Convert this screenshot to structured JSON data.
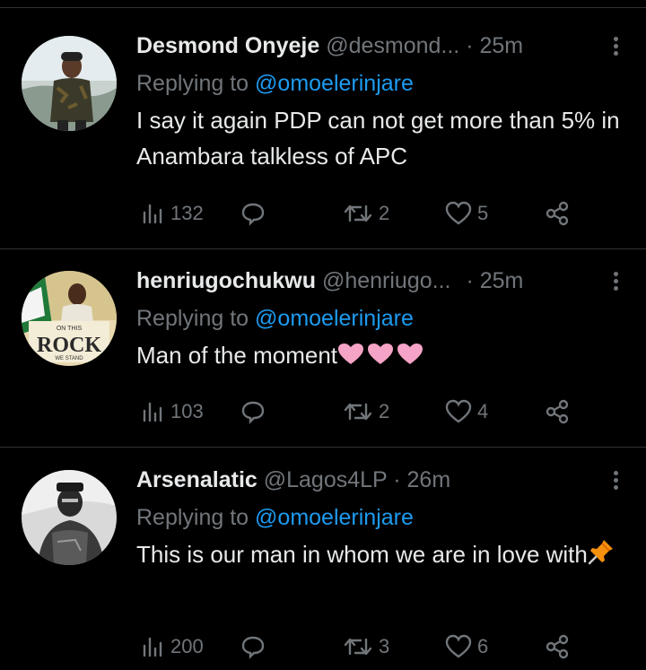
{
  "tweets": [
    {
      "name": "Desmond Onyeje",
      "handle": "@desmond...",
      "time": "· 25m",
      "replying_prefix": "Replying to ",
      "replying_to": "@omoelerinjare",
      "text": "I say it again PDP can not get more than 5% in Anambara talkless of APC",
      "views": "132",
      "retweets": "2",
      "likes": "5"
    },
    {
      "name": "henriugochukwu",
      "handle": "@henriugo...",
      "time": "· 25m",
      "replying_prefix": "Replying to ",
      "replying_to": "@omoelerinjare",
      "text": "Man of the moment",
      "views": "103",
      "retweets": "2",
      "likes": "4",
      "avatar_text_top": "ON THIS",
      "avatar_text_main": "ROCK",
      "avatar_text_bottom": "WE STAND"
    },
    {
      "name": "Arsenalatic",
      "handle": "@Lagos4LP",
      "time": "· 26m",
      "replying_prefix": "Replying to ",
      "replying_to": "@omoelerinjare",
      "text": "This is our man in whom we are in love with",
      "views": "200",
      "retweets": "3",
      "likes": "6"
    }
  ],
  "colors": {
    "background": "#000000",
    "text": "#e7e9ea",
    "muted": "#71767b",
    "mention": "#1d9bf0",
    "heart": "#f5a3c7"
  },
  "icons": [
    "views-icon",
    "reply-icon",
    "retweet-icon",
    "like-icon",
    "share-icon",
    "more-icon",
    "heart-emoji",
    "pushpin-emoji"
  ]
}
